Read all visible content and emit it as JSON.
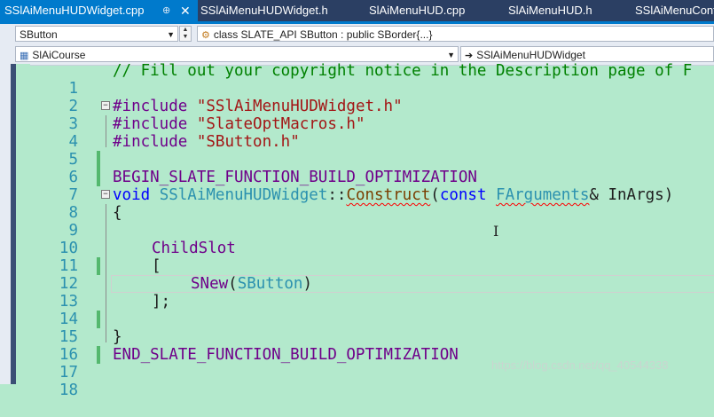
{
  "tabs": [
    {
      "label": "SSlAiMenuHUDWidget.cpp",
      "active": true,
      "pin": "⊕",
      "close": "✕"
    },
    {
      "label": "SSlAiMenuHUDWidget.h"
    },
    {
      "label": "SlAiMenuHUD.cpp"
    },
    {
      "label": "SlAiMenuHUD.h"
    },
    {
      "label": "SSlAiMenuContro"
    }
  ],
  "navbar1": {
    "scope_combo": "SButton",
    "member_combo": "class SLATE_API SButton : public SBorder{...}"
  },
  "navbar2": {
    "project_combo": "SlAiCourse",
    "file_combo": "SSlAiMenuHUDWidget"
  },
  "colors": {
    "editor_bg": "#b3e9cc",
    "tab_active": "#007acc",
    "tabstrip_bg": "#2b3f63",
    "change_marker": "#54b86e"
  },
  "icons": {
    "member_icon": "class-icon",
    "file_icon": "arrow-right-icon",
    "project_icon": "project-icon"
  },
  "code": {
    "line_numbers": [
      "1",
      "2",
      "3",
      "4",
      "5",
      "6",
      "7",
      "8",
      "9",
      "10",
      "11",
      "12",
      "13",
      "14",
      "15",
      "16",
      "17",
      "18"
    ],
    "l1": "// Fill out your copyright notice in the Description page of F",
    "l3_pp": "#include",
    "l3_str": "\"SSlAiMenuHUDWidget.h\"",
    "l4_pp": "#include",
    "l4_str": "\"SlateOptMacros.h\"",
    "l5_pp": "#include",
    "l5_str": "\"SButton.h\"",
    "l7": "BEGIN_SLATE_FUNCTION_BUILD_OPTIMIZATION",
    "l8_void": "void",
    "l8_class": "SSlAiMenuHUDWidget",
    "l8_sep": "::",
    "l8_fn": "Construct",
    "l8_open": "(",
    "l8_const": "const",
    "l8_type": "FArguments",
    "l8_rest": "& InArgs)",
    "l9": "{",
    "l11": "ChildSlot",
    "l12": "[",
    "l13_fn": "SNew",
    "l13_open": "(",
    "l13_type": "SButton",
    "l13_close": ")",
    "l14": "];",
    "l16": "}",
    "l17": "END_SLATE_FUNCTION_BUILD_OPTIMIZATION"
  },
  "watermark": "https://blog.csdn.net/qq_40544338"
}
